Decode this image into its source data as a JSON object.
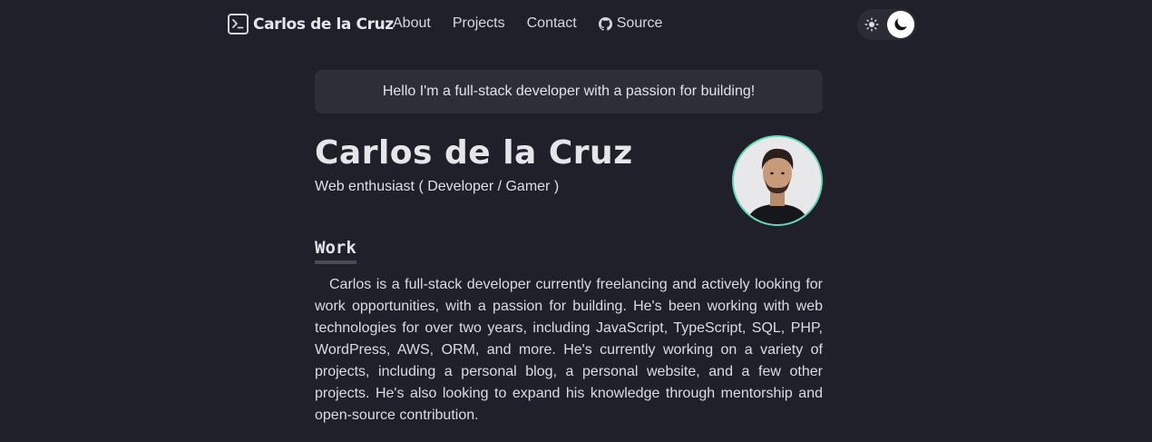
{
  "nav": {
    "logo_text": "Carlos de la Cruz",
    "links": [
      {
        "label": "About"
      },
      {
        "label": "Projects"
      },
      {
        "label": "Contact"
      },
      {
        "label": "Source",
        "icon": "github-icon"
      }
    ],
    "theme_toggle": {
      "state": "dark",
      "light_icon": "sun-icon",
      "dark_icon": "moon-icon"
    }
  },
  "greeting": "Hello I'm a full-stack developer with a passion for building!",
  "profile": {
    "name": "Carlos de la Cruz",
    "role": "Web enthusiast ( Developer / Gamer )"
  },
  "work": {
    "heading": "Work",
    "body": "Carlos is a full-stack developer currently freelancing and actively looking for work opportunities, with a passion for building. He's been working with web technologies for over two years, including JavaScript, TypeScript, SQL, PHP, WordPress, AWS, ORM, and more. He's currently working on a variety of projects, including a personal blog, a personal website, and a few other projects. He's also looking to expand his knowledge through mentorship and open-source contribution."
  },
  "colors": {
    "background": "#1f202a",
    "card": "#2d2e37",
    "avatar_ring": "#63d7b7"
  }
}
